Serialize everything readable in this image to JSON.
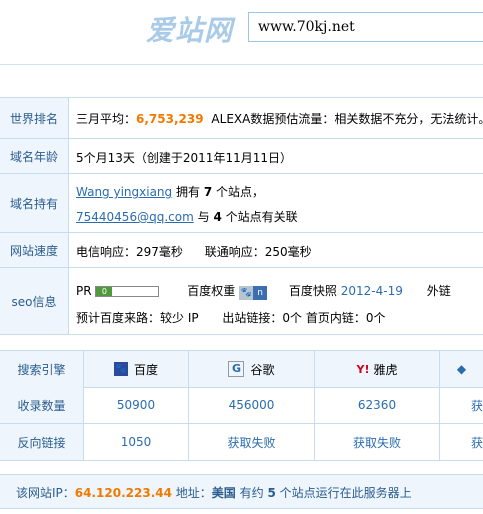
{
  "header": {
    "logo": "爱站网",
    "url": "www.70kj.net"
  },
  "rows": {
    "rank": {
      "label": "世界排名",
      "prefix": "三月平均：",
      "value": "6,753,239",
      "alexa": "ALEXA数据预估流量：相关数据不充分，无法统计。"
    },
    "age": {
      "label": "域名年龄",
      "text": "5个月13天（创建于2011年11月11日）"
    },
    "owner": {
      "label": "域名持有",
      "name": "Wang yingxiang",
      "owns1": "拥有",
      "count1": "7",
      "owns1b": "个站点，",
      "email": "75440456@qq.com",
      "owns2": "与",
      "count2": "4",
      "owns2b": "个站点有关联"
    },
    "speed": {
      "label": "网站速度",
      "telecom": "电信响应：297毫秒",
      "unicom": "联通响应：250毫秒"
    },
    "seo": {
      "label": "seo信息",
      "pr_label": "PR",
      "pr_value": "0",
      "baidu_weight_label": "百度权重",
      "baidu_weight": "n",
      "snapshot_label": "百度快照",
      "snapshot_date": "2012-4-19",
      "external_label": "外链",
      "line2": "预计百度来路：较少 IP",
      "out_links": "出站链接：0个",
      "home_links": "首页内链：0个"
    }
  },
  "stats": {
    "header": [
      "搜索引擎",
      "百度",
      "谷歌",
      "雅虎"
    ],
    "icons": [
      "baidu-paw-icon",
      "google-g-icon",
      "yahoo-y-icon"
    ],
    "indexed": {
      "label": "收录数量",
      "values": [
        "50900",
        "456000",
        "62360"
      ]
    },
    "backlinks": {
      "label": "反向链接",
      "values": [
        "1050",
        "获取失败",
        "获取失败"
      ]
    },
    "cut_text": "获"
  },
  "footer": {
    "prefix": "该网站IP：",
    "ip": "64.120.223.44",
    "address": "地址：",
    "country": "美国",
    "mid": "有约",
    "count": "5",
    "suffix": "个站点运行在此服务器上"
  }
}
